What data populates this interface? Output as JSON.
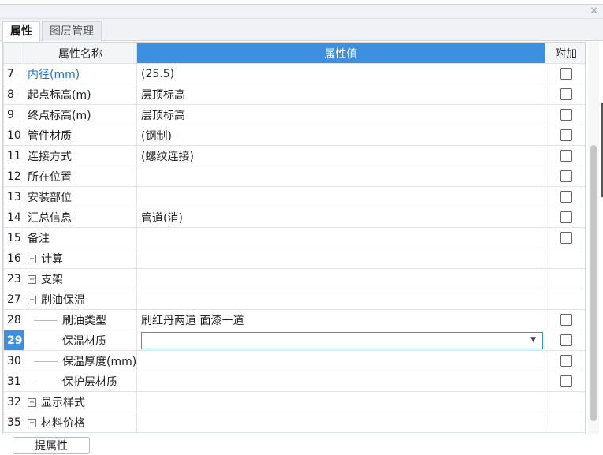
{
  "dialog": {
    "close_icon": "close-icon"
  },
  "tabs": [
    {
      "label": "属性",
      "active": true
    },
    {
      "label": "图层管理",
      "active": false
    }
  ],
  "grid": {
    "headers": {
      "name": "属性名称",
      "value": "属性值",
      "extra": "附加"
    },
    "selected_row": "29",
    "rows": [
      {
        "idx": "7",
        "name": "内径(mm)",
        "value": "(25.5)",
        "checkbox": true,
        "blue": true
      },
      {
        "idx": "8",
        "name": "起点标高(m)",
        "value": "层顶标高",
        "checkbox": true
      },
      {
        "idx": "9",
        "name": "终点标高(m)",
        "value": "层顶标高",
        "checkbox": true
      },
      {
        "idx": "10",
        "name": "管件材质",
        "value": "(钢制)",
        "checkbox": true
      },
      {
        "idx": "11",
        "name": "连接方式",
        "value": "(螺纹连接)",
        "checkbox": true
      },
      {
        "idx": "12",
        "name": "所在位置",
        "value": "",
        "checkbox": true
      },
      {
        "idx": "13",
        "name": "安装部位",
        "value": "",
        "checkbox": true
      },
      {
        "idx": "14",
        "name": "汇总信息",
        "value": "管道(消)",
        "checkbox": true
      },
      {
        "idx": "15",
        "name": "备注",
        "value": "",
        "checkbox": true
      },
      {
        "idx": "16",
        "name": "计算",
        "value": "",
        "group": "plus",
        "checkbox": false
      },
      {
        "idx": "23",
        "name": "支架",
        "value": "",
        "group": "plus",
        "checkbox": false
      },
      {
        "idx": "27",
        "name": "刷油保温",
        "value": "",
        "group": "minus",
        "checkbox": false
      },
      {
        "idx": "28",
        "name": "刷油类型",
        "value": "刷红丹两道 面漆一道",
        "child": true,
        "checkbox": true
      },
      {
        "idx": "29",
        "name": "保温材质",
        "value": "",
        "child": true,
        "checkbox": true,
        "combo": true
      },
      {
        "idx": "30",
        "name": "保温厚度(mm)",
        "value": "",
        "child": true,
        "checkbox": true
      },
      {
        "idx": "31",
        "name": "保护层材质",
        "value": "",
        "child": true,
        "checkbox": true
      },
      {
        "idx": "32",
        "name": "显示样式",
        "value": "",
        "group": "plus",
        "checkbox": false
      },
      {
        "idx": "35",
        "name": "材料价格",
        "value": "",
        "group": "plus",
        "checkbox": false
      }
    ]
  },
  "bottom_button": {
    "label": "提属性"
  },
  "colors": {
    "accent": "#3d8fe0",
    "link": "#1a6fd8"
  }
}
